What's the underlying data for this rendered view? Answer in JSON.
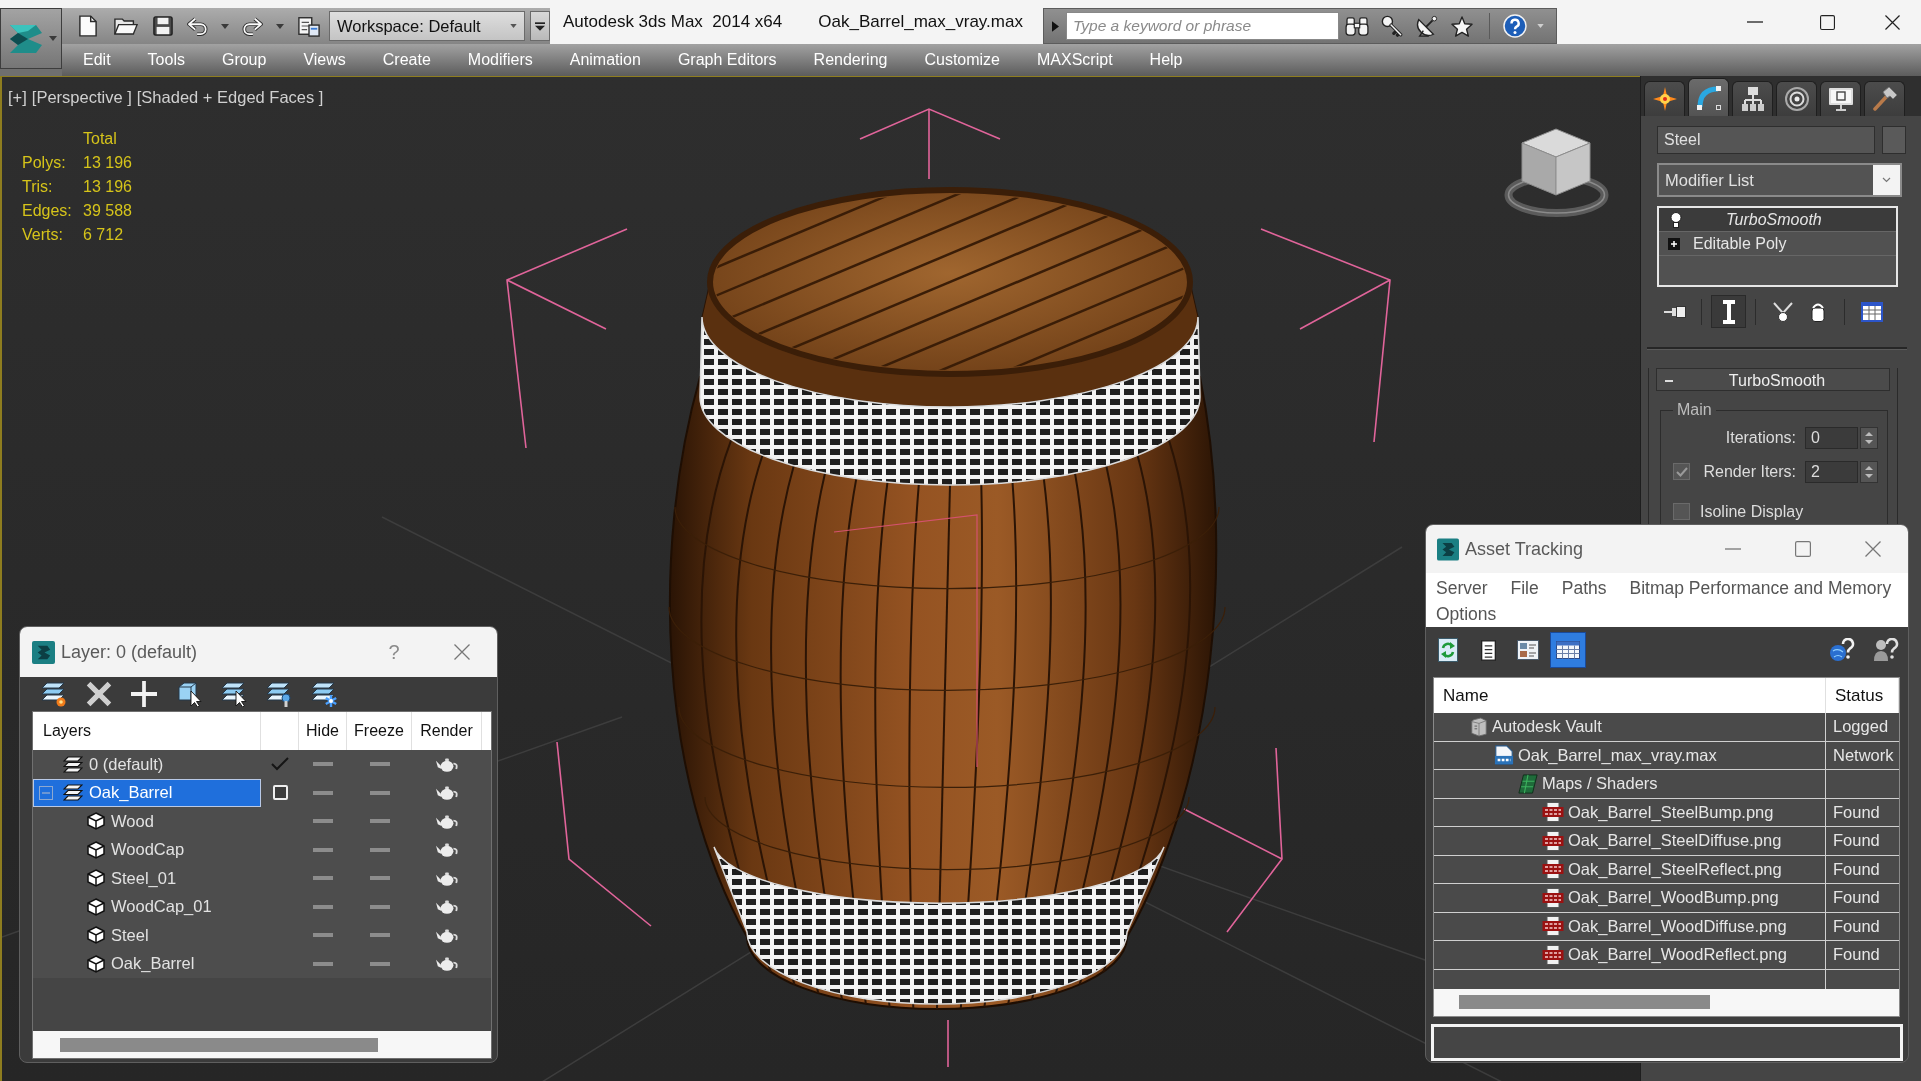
{
  "title_bar": {
    "app_title": "Autodesk 3ds Max  2014 x64",
    "file_name": "Oak_Barrel_max_vray.max",
    "workspace": "Workspace: Default",
    "search": {
      "placeholder": "Type a keyword or phrase"
    }
  },
  "menu": [
    "Edit",
    "Tools",
    "Group",
    "Views",
    "Create",
    "Modifiers",
    "Animation",
    "Graph Editors",
    "Rendering",
    "Customize",
    "MAXScript",
    "Help"
  ],
  "viewport": {
    "labels": [
      "[+]",
      "[Perspective ]",
      "[Shaded + Edged Faces ]"
    ],
    "stats": {
      "header": "Total",
      "rows": [
        {
          "label": "Polys:",
          "value": "13 196"
        },
        {
          "label": "Tris:",
          "value": "13 196"
        },
        {
          "label": "Edges:",
          "value": "39 588"
        },
        {
          "label": "Verts:",
          "value": "6 712"
        }
      ]
    }
  },
  "command_panel": {
    "tabs": [
      {
        "selected": false
      },
      {
        "selected": true
      },
      {
        "selected": false
      },
      {
        "selected": false
      },
      {
        "selected": false
      },
      {
        "selected": false
      }
    ],
    "object_name": "Steel",
    "modifier_list": "Modifier List",
    "stack": [
      {
        "label": "TurboSmooth",
        "kind": "modifier",
        "selected": true
      },
      {
        "label": "Editable Poly",
        "kind": "base_object",
        "selected": false
      }
    ],
    "stack_tools": [
      {
        "selected": false
      },
      {
        "selected": true
      },
      {
        "selected": false
      },
      {
        "selected": false
      },
      {
        "selected": false
      }
    ],
    "rollout": {
      "title": "TurboSmooth",
      "expanded": true,
      "group": "Main",
      "fields": [
        {
          "kind": "spinner",
          "label": "Iterations:",
          "value": "0"
        },
        {
          "kind": "spinner",
          "label": "Render Iters:",
          "value": "2",
          "checked": true
        },
        {
          "kind": "checkbox",
          "label": "Isoline Display",
          "checked": false
        }
      ]
    }
  },
  "layer_dialog": {
    "title": "Layer: 0 (default)",
    "help": "?",
    "columns": [
      "Layers",
      "Hide",
      "Freeze",
      "Render"
    ],
    "layers": [
      {
        "name": "0 (default)",
        "selected": false,
        "current": true,
        "hidden": false,
        "frozen": false,
        "render": true
      },
      {
        "name": "Oak_Barrel",
        "selected": true,
        "current": false,
        "expanded": true,
        "hidden": false,
        "frozen": false,
        "render": true,
        "children": [
          {
            "name": "Wood",
            "selected": false,
            "hidden": false,
            "frozen": false,
            "render": true
          },
          {
            "name": "WoodCap",
            "selected": false,
            "hidden": false,
            "frozen": false,
            "render": true
          },
          {
            "name": "Steel_01",
            "selected": false,
            "hidden": false,
            "frozen": false,
            "render": true
          },
          {
            "name": "WoodCap_01",
            "selected": false,
            "hidden": false,
            "frozen": false,
            "render": true
          },
          {
            "name": "Steel",
            "selected": false,
            "hidden": false,
            "frozen": false,
            "render": true
          },
          {
            "name": "Oak_Barrel",
            "selected": false,
            "hidden": false,
            "frozen": false,
            "render": true
          }
        ]
      }
    ]
  },
  "asset_tracking": {
    "title": "Asset Tracking",
    "menu": [
      "Server",
      "File",
      "Paths",
      "Bitmap Performance and Memory",
      "Options"
    ],
    "view_buttons": [
      {
        "selected": false
      },
      {
        "selected": false
      },
      {
        "selected": false
      },
      {
        "selected": true
      }
    ],
    "columns": [
      "Name",
      "Status"
    ],
    "tree": [
      {
        "name": "Autodesk Vault",
        "status": "Logged",
        "children": [
          {
            "name": "Oak_Barrel_max_vray.max",
            "status": "Network",
            "children": [
              {
                "name": "Maps / Shaders",
                "children": [
                  {
                    "name": "Oak_Barrel_SteelBump.png",
                    "status": "Found"
                  },
                  {
                    "name": "Oak_Barrel_SteelDiffuse.png",
                    "status": "Found"
                  },
                  {
                    "name": "Oak_Barrel_SteelReflect.png",
                    "status": "Found"
                  },
                  {
                    "name": "Oak_Barrel_WoodBump.png",
                    "status": "Found"
                  },
                  {
                    "name": "Oak_Barrel_WoodDiffuse.png",
                    "status": "Found"
                  },
                  {
                    "name": "Oak_Barrel_WoodReflect.png",
                    "status": "Found"
                  }
                ]
              }
            ]
          }
        ]
      }
    ]
  }
}
